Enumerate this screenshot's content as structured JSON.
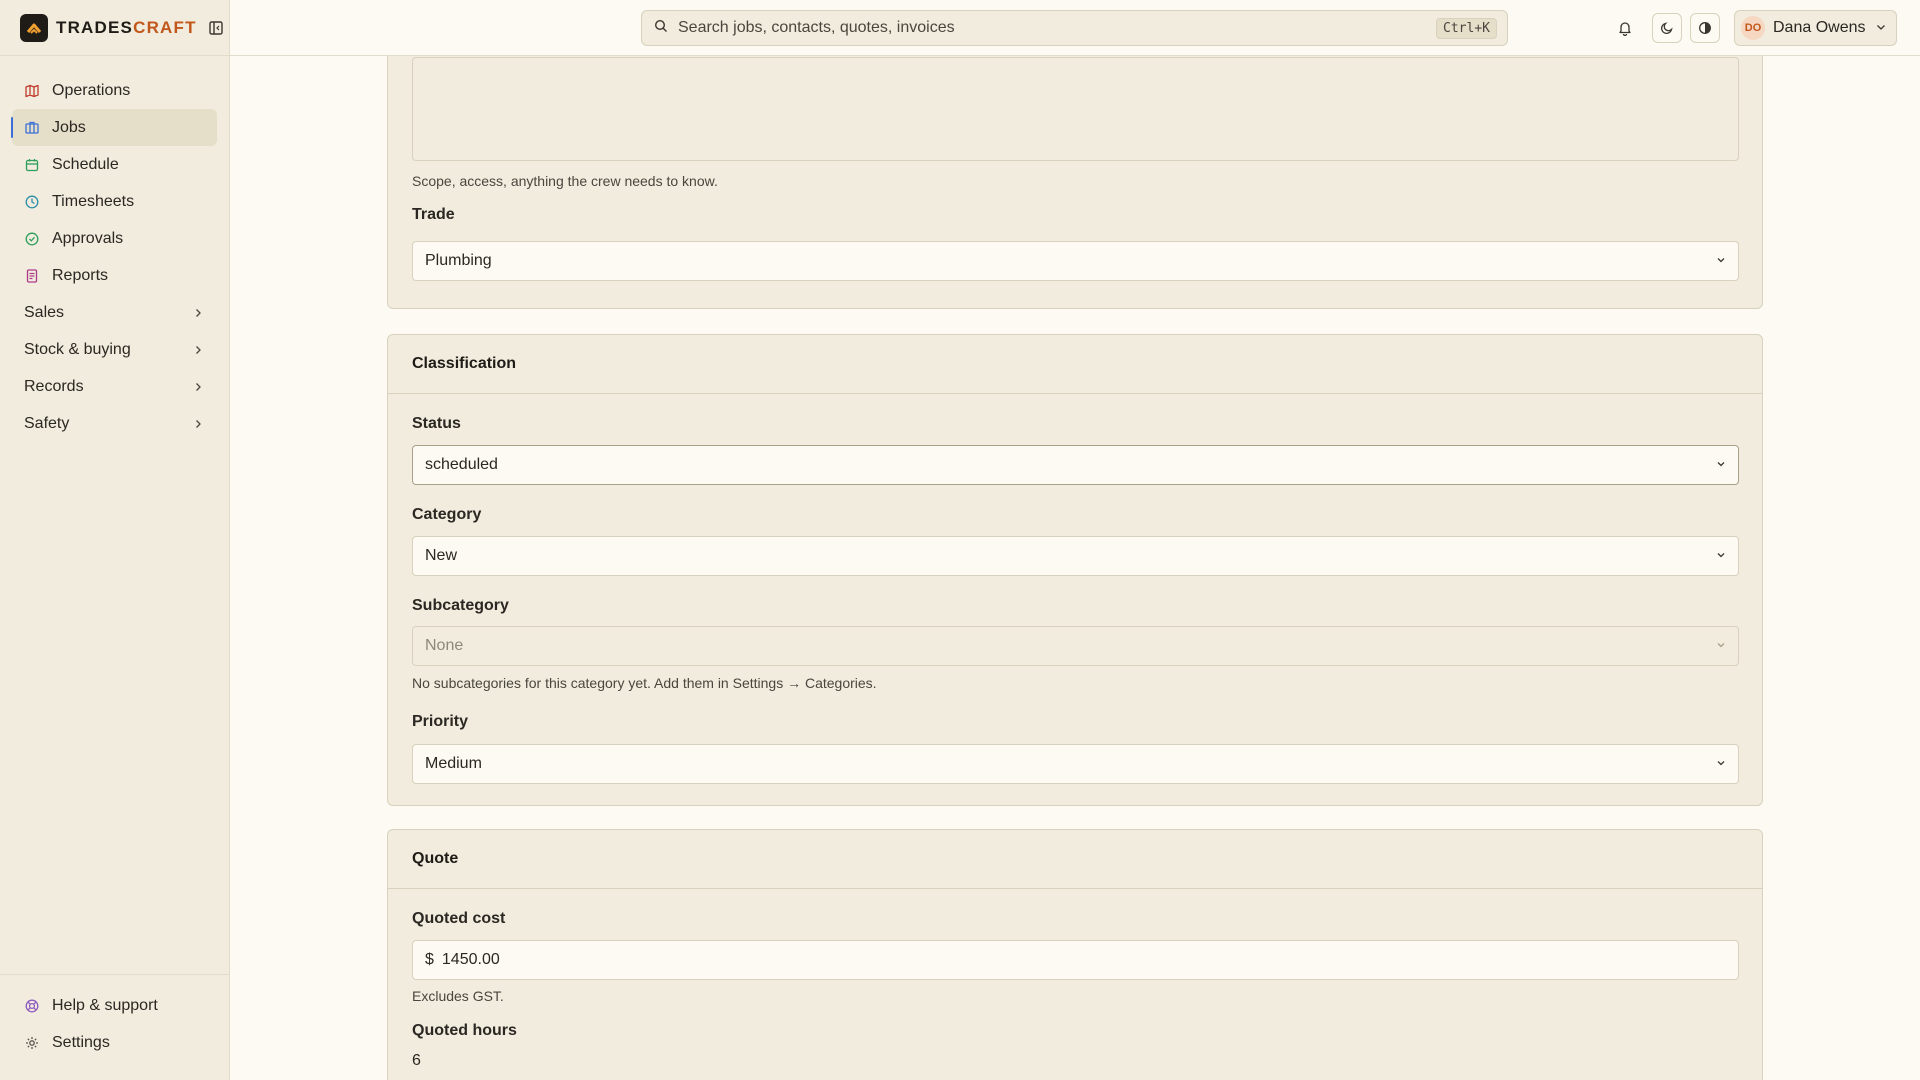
{
  "brand": {
    "name_main": "TRADES",
    "name_accent": "CRAFT",
    "logo_icon": "chevron-up-logo"
  },
  "sidebar": {
    "items": [
      {
        "label": "Operations",
        "icon": "map-icon",
        "color": "#c0392b"
      },
      {
        "label": "Jobs",
        "icon": "briefcase-icon",
        "color": "#3b6fd8",
        "active": true
      },
      {
        "label": "Schedule",
        "icon": "calendar-icon",
        "color": "#2e9e5b"
      },
      {
        "label": "Timesheets",
        "icon": "clock-icon",
        "color": "#2a8fa8"
      },
      {
        "label": "Approvals",
        "icon": "check-circle-icon",
        "color": "#2e9e5b"
      },
      {
        "label": "Reports",
        "icon": "document-icon",
        "color": "#b03a8a"
      }
    ],
    "groups": [
      {
        "label": "Sales"
      },
      {
        "label": "Stock & buying"
      },
      {
        "label": "Records"
      },
      {
        "label": "Safety"
      }
    ],
    "footer": [
      {
        "label": "Help & support",
        "icon": "lifebuoy-icon",
        "color": "#8e5bbf"
      },
      {
        "label": "Settings",
        "icon": "gear-icon",
        "color": "#5a554c"
      }
    ]
  },
  "topbar": {
    "search_placeholder": "Search jobs, contacts, quotes, invoices",
    "search_shortcut": "Ctrl+K",
    "user_initials": "DO",
    "user_name": "Dana Owens"
  },
  "details": {
    "notes_hint": "Scope, access, anything the crew needs to know.",
    "trade_label": "Trade",
    "trade_value": "Plumbing"
  },
  "classification": {
    "title": "Classification",
    "status_label": "Status",
    "status_value": "scheduled",
    "category_label": "Category",
    "category_value": "New",
    "subcategory_label": "Subcategory",
    "subcategory_value": "None",
    "subcategory_hint": "No subcategories for this category yet. Add them in Settings → Categories.",
    "priority_label": "Priority",
    "priority_value": "Medium"
  },
  "quote": {
    "title": "Quote",
    "cost_label": "Quoted cost",
    "currency": "$",
    "cost_value": "1450.00",
    "cost_hint": "Excludes GST.",
    "hours_label": "Quoted hours",
    "hours_value": "6"
  }
}
